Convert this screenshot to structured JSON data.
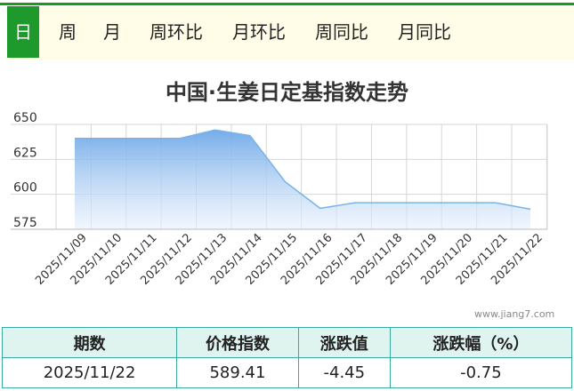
{
  "tabs": [
    {
      "label": "日",
      "active": true
    },
    {
      "label": "周",
      "active": false
    },
    {
      "label": "月",
      "active": false
    },
    {
      "label": "周环比",
      "active": false
    },
    {
      "label": "月环比",
      "active": false
    },
    {
      "label": "周同比",
      "active": false
    },
    {
      "label": "月同比",
      "active": false
    }
  ],
  "watermark": "www.jiang7.com",
  "table": {
    "headers": [
      "期数",
      "价格指数",
      "涨跌值",
      "涨跌幅（%）"
    ],
    "row": [
      "2025/11/22",
      "589.41",
      "-4.45",
      "-0.75"
    ]
  },
  "colors": {
    "accent": "#1e9a2c",
    "line": "#7ab3e8",
    "fill_top": "#6ea8e8",
    "fill_bottom": "#e8f1fc",
    "table_border": "#3aa9a0",
    "table_header_bg": "#dff3ef"
  },
  "chart_data": {
    "type": "area",
    "title": "中国·生姜日定基指数走势",
    "xlabel": "",
    "ylabel": "",
    "ylim": [
      575,
      650
    ],
    "yticks": [
      575,
      600,
      625,
      650
    ],
    "grid": true,
    "categories": [
      "2025/11/09",
      "2025/11/10",
      "2025/11/11",
      "2025/11/12",
      "2025/11/13",
      "2025/11/14",
      "2025/11/15",
      "2025/11/16",
      "2025/11/17",
      "2025/11/18",
      "2025/11/19",
      "2025/11/20",
      "2025/11/21",
      "2025/11/22"
    ],
    "series": [
      {
        "values": [
          640,
          640,
          640,
          640,
          646,
          642,
          609,
          590,
          594,
          594,
          594,
          594,
          594,
          589.41
        ]
      }
    ]
  }
}
